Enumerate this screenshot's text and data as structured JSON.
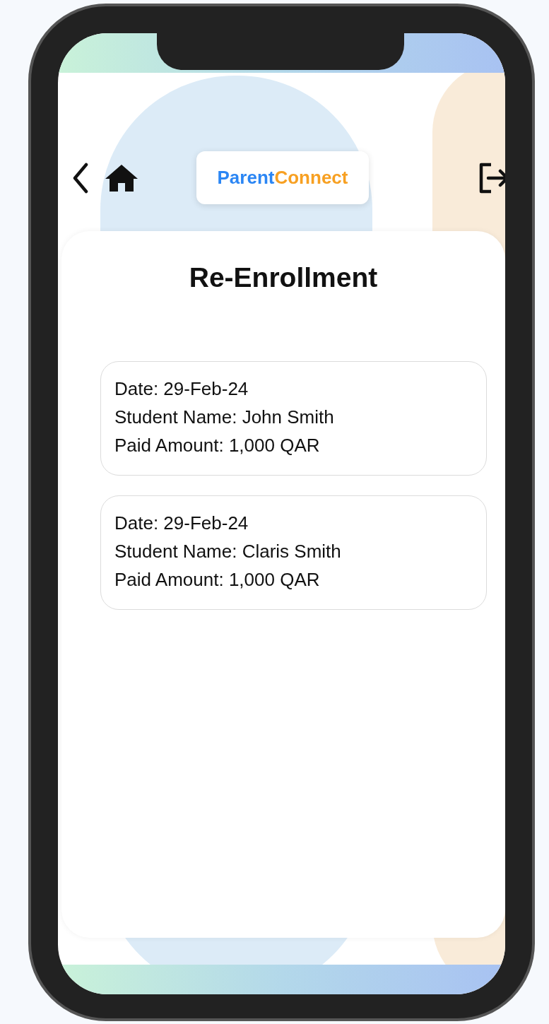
{
  "header": {
    "logo": [
      {
        "text": "Parent",
        "color": "#2b86f4"
      },
      {
        "text": "Connect",
        "color": "#f7a022"
      }
    ]
  },
  "page": {
    "title": "Re-Enrollment"
  },
  "records": [
    {
      "date": "Date: 29-Feb-24",
      "student": "Student Name: John Smith",
      "amount": "Paid Amount: 1,000 QAR"
    },
    {
      "date": "Date: 29-Feb-24",
      "student": "Student Name: Claris Smith",
      "amount": "Paid Amount: 1,000 QAR"
    }
  ]
}
